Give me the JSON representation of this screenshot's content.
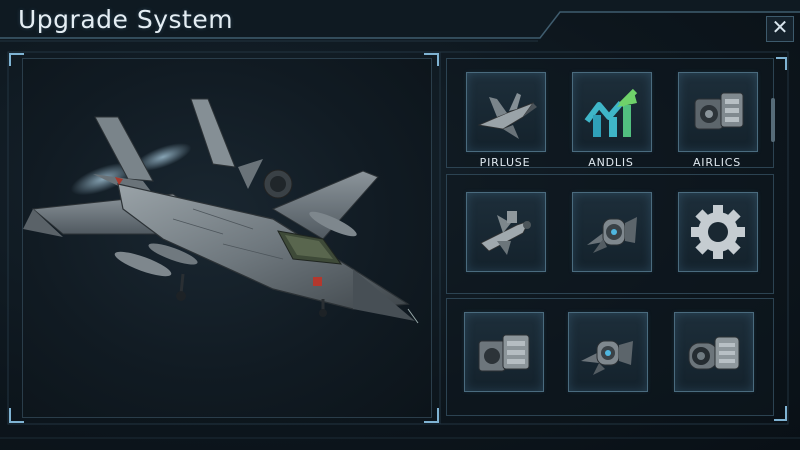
{
  "window": {
    "title": "Upgrade System",
    "close_symbol": "✕"
  },
  "colors": {
    "accent": "#7fb3d3",
    "frame": "#2c4352",
    "panel_bg": "#0d161d"
  },
  "preview": {
    "image": "fighter-jet",
    "icon": "fighter-jet-icon"
  },
  "upgrade_slots": [
    {
      "label": "PIRLUSE",
      "icon": "jet-icon"
    },
    {
      "label": "ANDLIS",
      "icon": "growth-arrows-icon"
    },
    {
      "label": "AIRLICS",
      "icon": "engine-block-icon"
    },
    {
      "label": "",
      "icon": "missile-icon"
    },
    {
      "label": "",
      "icon": "turbine-icon"
    },
    {
      "label": "",
      "icon": "gear-icon"
    },
    {
      "label": "",
      "icon": "engine-block-icon"
    },
    {
      "label": "",
      "icon": "turbine-icon"
    },
    {
      "label": "",
      "icon": "thruster-icon"
    }
  ]
}
